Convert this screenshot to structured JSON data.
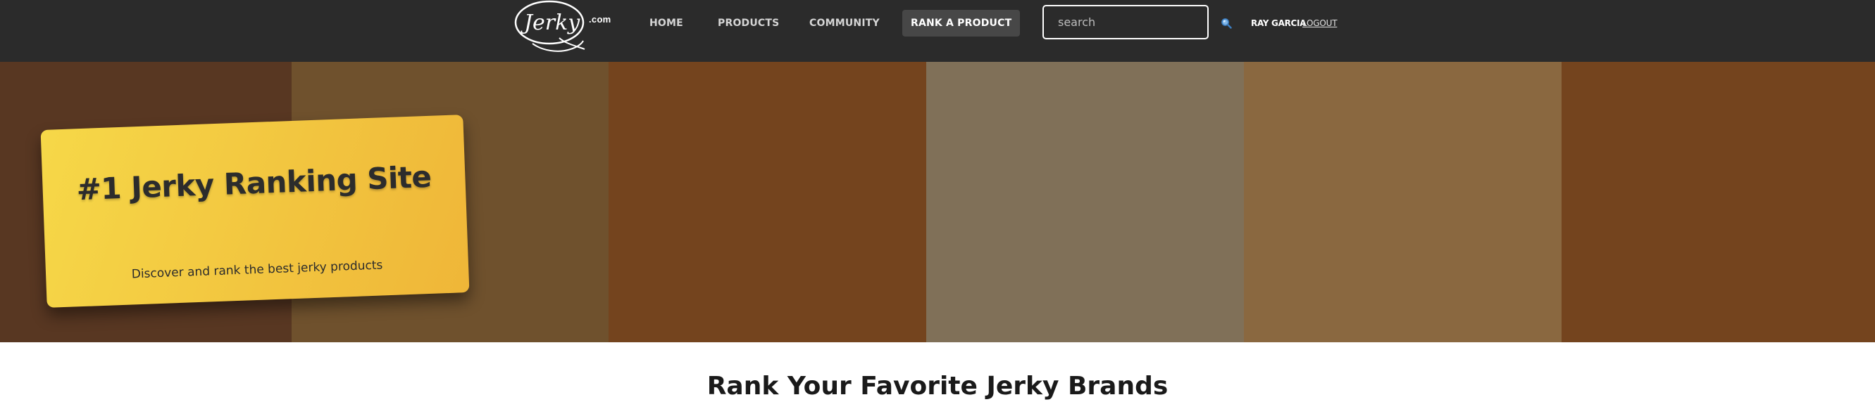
{
  "brand": {
    "logo_text": "Jerky",
    "domain_suffix": ".com"
  },
  "nav": {
    "home": "HOME",
    "products": "PRODUCTS",
    "community": "COMMUNITY",
    "rank_product": "RANK A PRODUCT"
  },
  "search": {
    "placeholder": "search",
    "value": "",
    "icon": "search-icon"
  },
  "user": {
    "name": "RAY GARCIA",
    "logout": "LOGOUT"
  },
  "hero": {
    "title": "#1 Jerky Ranking Site",
    "subtitle": "Discover and rank the best jerky products",
    "stripe_colors": [
      "#583722",
      "#6f512d",
      "#74441e",
      "#807058",
      "#8a6840",
      "#74441e"
    ]
  },
  "section": {
    "title": "Rank Your Favorite Jerky Brands"
  },
  "colors": {
    "header_bg": "#2b2b2b",
    "rank_button_bg": "#474747",
    "card_gradient_start": "#f6d848",
    "card_gradient_end": "#efb638"
  }
}
